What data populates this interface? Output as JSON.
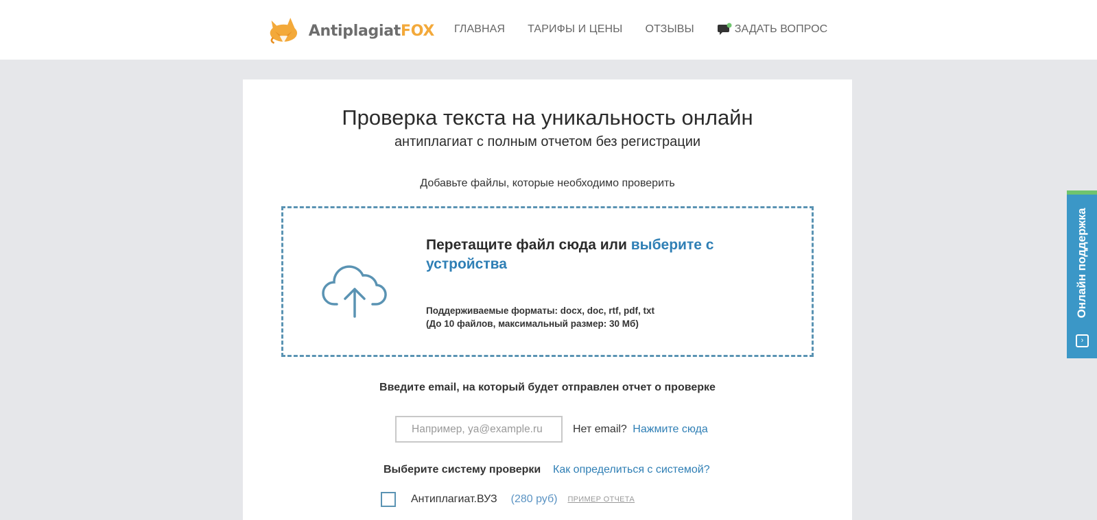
{
  "header": {
    "logo": {
      "text_a": "Antiplagiat",
      "text_b": "FOX"
    },
    "nav": [
      {
        "label": "ГЛАВНАЯ"
      },
      {
        "label": "ТАРИФЫ И ЦЕНЫ"
      },
      {
        "label": "ОТЗЫВЫ"
      },
      {
        "label": "ЗАДАТЬ ВОПРОС"
      }
    ]
  },
  "main": {
    "title": "Проверка текста на уникальность онлайн",
    "subtitle": "антиплагиат с полным отчетом без регистрации",
    "add_hint": "Добавьте файлы, которые необходимо проверить",
    "dropzone": {
      "text": "Перетащите файл сюда или",
      "link": "выберите с устройства",
      "formats": "Поддерживаемые форматы: docx, doc, rtf, pdf, txt",
      "limits": "(До 10 файлов, максимальный размер: 30 Мб)"
    },
    "email": {
      "label": "Введите email, на который будет отправлен отчет о проверке",
      "placeholder": "Например, ya@example.ru",
      "no_email": "Нет email?",
      "no_email_link": "Нажмите сюда"
    },
    "system": {
      "label": "Выберите систему проверки",
      "help_link": "Как определиться с системой?",
      "options": [
        {
          "name": "Антиплагиат.ВУЗ",
          "price": "(280 руб)",
          "sample": "ПРИМЕР ОТЧЕТА",
          "checked": false
        }
      ]
    }
  },
  "support_tab": {
    "label": "Онлайн поддержка"
  },
  "colors": {
    "accent": "#2f7fb5",
    "brand_orange": "#f3a93a",
    "dashed_border": "#5a93b3",
    "support_bg": "#3b97c7",
    "support_top": "#6fc46e"
  }
}
